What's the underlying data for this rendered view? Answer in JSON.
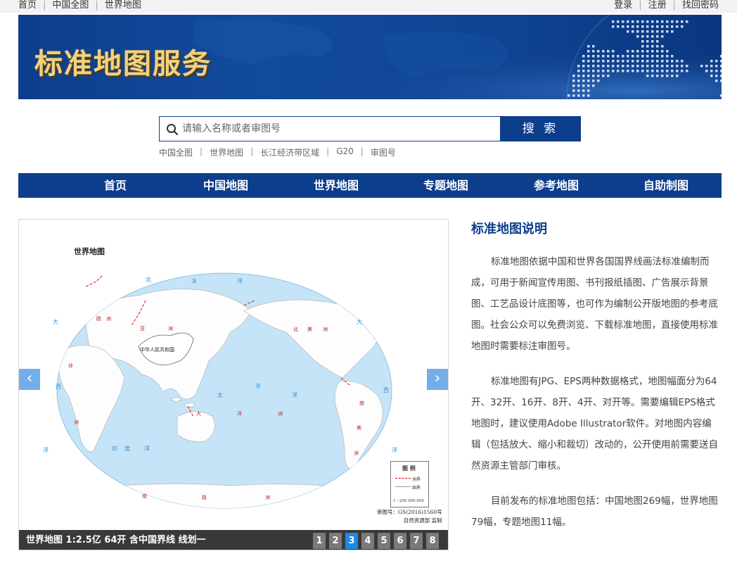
{
  "topbar": {
    "left": [
      "首页",
      "中国全图",
      "世界地图"
    ],
    "right": [
      "登录",
      "注册",
      "找回密码"
    ]
  },
  "banner": {
    "title": "标准地图服务"
  },
  "search": {
    "placeholder": "请输入名称或者审图号",
    "value": "",
    "button": "搜 索"
  },
  "quick_links": [
    "中国全图",
    "世界地图",
    "长江经济带区域",
    "G20",
    "审图号"
  ],
  "nav": [
    "首页",
    "中国地图",
    "世界地图",
    "专题地图",
    "参考地图",
    "自助制图"
  ],
  "map": {
    "title": "世界地图",
    "legend_title": "图 例",
    "legend_items": [
      "洲界",
      "国界"
    ],
    "scale": "1 : 250 000 000",
    "approval_no": "审图号：GS(2016)1560号",
    "supervisor": "自然资源部 监制",
    "labels": {
      "north_ocean": [
        "北",
        "冰",
        "洋"
      ],
      "europe": [
        "欧",
        "洲"
      ],
      "asia": [
        "亚",
        "洲"
      ],
      "china": "中华人民共和国",
      "africa": [
        "非",
        "洲"
      ],
      "north_america": [
        "北",
        "美",
        "洲"
      ],
      "south_america": [
        "南",
        "美",
        "洲"
      ],
      "pacific": [
        "太",
        "平",
        "洋"
      ],
      "indian": [
        "印",
        "度",
        "洋"
      ],
      "atlantic_left": [
        "大",
        "西",
        "洋"
      ],
      "atlantic_right": [
        "大",
        "西",
        "洋"
      ],
      "oceania": [
        "大",
        "洋",
        "洲"
      ],
      "antarctica": [
        "南",
        "极",
        "洲"
      ]
    },
    "caption": "世界地图 1:2.5亿 64开 含中国界线 线划一",
    "pages": [
      "1",
      "2",
      "3",
      "4",
      "5",
      "6",
      "7",
      "8"
    ],
    "active_page": "3",
    "prev_glyph": "‹",
    "next_glyph": "›"
  },
  "side": {
    "heading": "标准地图说明",
    "paragraphs": [
      "标准地图依据中国和世界各国国界线画法标准编制而成，可用于新闻宣传用图、书刊报纸插图、广告展示背景图、工艺品设计底图等，也可作为编制公开版地图的参考底图。社会公众可以免费浏览、下载标准地图，直接使用标准地图时需要标注审图号。",
      "标准地图有JPG、EPS两种数据格式，地图幅面分为64开、32开、16开、8开、4开、对开等。需要编辑EPS格式地图时，建议使用Adobe Illustrator软件。对地图内容编辑（包括放大、缩小和裁切）改动的，公开使用前需要送自然资源主管部门审核。",
      "目前发布的标准地图包括：中国地图269幅，世界地图79幅，专题地图11幅。"
    ]
  },
  "colors": {
    "brand": "#0d3e8c",
    "ocean": "#c6e4f7",
    "active_page": "#1e88e5",
    "title_gold": "#f3d27c"
  },
  "icons": {
    "search": "search-icon"
  }
}
